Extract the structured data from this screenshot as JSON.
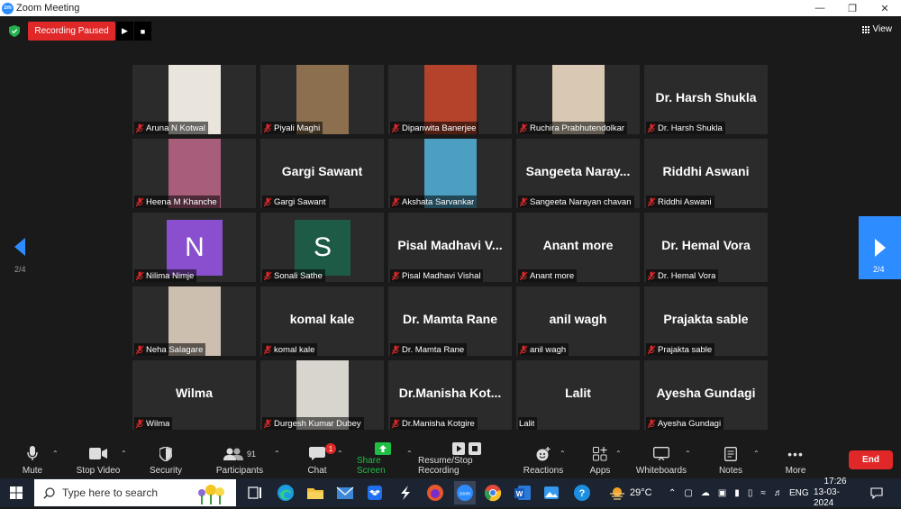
{
  "window": {
    "title": "Zoom Meeting",
    "logo": "zm"
  },
  "topbar": {
    "recording_label": "Recording Paused",
    "view_label": "View"
  },
  "gallery": {
    "page_indicator": "2/4",
    "tiles": [
      {
        "label": "Aruna N Kotwal",
        "kind": "video",
        "bg": "#e9e4dc"
      },
      {
        "label": "Piyali Maghi",
        "kind": "video",
        "bg": "#8c6f4f"
      },
      {
        "label": "Dipanwita Banerjee",
        "kind": "video",
        "bg": "#b4432c"
      },
      {
        "label": "Ruchira Prabhutendolkar",
        "kind": "video",
        "bg": "#d9c9b4"
      },
      {
        "label": "Dr. Harsh Shukla",
        "kind": "name",
        "display": "Dr. Harsh Shukla"
      },
      {
        "label": "Heena M Khanche",
        "kind": "video",
        "bg": "#a85e7b"
      },
      {
        "label": "Gargi Sawant",
        "kind": "name",
        "display": "Gargi Sawant"
      },
      {
        "label": "Akshata Sarvankar",
        "kind": "video",
        "bg": "#4c9fc1"
      },
      {
        "label": "Sangeeta Narayan  chavan",
        "kind": "name",
        "display": "Sangeeta  Naray..."
      },
      {
        "label": "Riddhi Aswani",
        "kind": "name",
        "display": "Riddhi Aswani"
      },
      {
        "label": "Nilima Nimje",
        "kind": "avatar",
        "initial": "N",
        "color": "#8a4fcf"
      },
      {
        "label": "Sonali Sathe",
        "kind": "avatar",
        "initial": "S",
        "color": "#1e5b46"
      },
      {
        "label": "Pisal Madhavi Vishal",
        "kind": "name",
        "display": "Pisal  Madhavi  V..."
      },
      {
        "label": "Anant more",
        "kind": "name",
        "display": "Anant more"
      },
      {
        "label": "Dr. Hemal Vora",
        "kind": "name",
        "display": "Dr. Hemal Vora"
      },
      {
        "label": "Neha Salagare",
        "kind": "video",
        "bg": "#cdbfb0"
      },
      {
        "label": "komal kale",
        "kind": "name",
        "display": "komal kale"
      },
      {
        "label": "Dr. Mamta Rane",
        "kind": "name",
        "display": "Dr. Mamta Rane"
      },
      {
        "label": "anil wagh",
        "kind": "name",
        "display": "anil wagh"
      },
      {
        "label": "Prajakta sable",
        "kind": "name",
        "display": "Prajakta sable"
      },
      {
        "label": "Wilma",
        "kind": "name",
        "display": "Wilma"
      },
      {
        "label": "Durgesh Kumar Dubey",
        "kind": "video",
        "bg": "#d8d5cf"
      },
      {
        "label": "Dr.Manisha Kotgire",
        "kind": "name",
        "display": "Dr.Manisha  Kot..."
      },
      {
        "label": "Lalit",
        "kind": "name",
        "display": "Lalit",
        "no_mic": true
      },
      {
        "label": "Ayesha Gundagi",
        "kind": "name",
        "display": "Ayesha Gundagi"
      }
    ]
  },
  "toolbar": {
    "mute": "Mute",
    "stop_video": "Stop Video",
    "security": "Security",
    "participants": "Participants",
    "participants_count": "91",
    "chat": "Chat",
    "chat_badge": "1",
    "share_screen": "Share Screen",
    "recording": "Resume/Stop Recording",
    "reactions": "Reactions",
    "apps": "Apps",
    "whiteboards": "Whiteboards",
    "notes": "Notes",
    "more": "More",
    "end": "End"
  },
  "taskbar": {
    "search_placeholder": "Type here to search",
    "weather": "29°C",
    "language": "ENG",
    "time": "17:26",
    "date": "13-03-2024"
  },
  "colors": {
    "accent": "#2d8cff",
    "danger": "#e02828",
    "share": "#1fbf45"
  }
}
